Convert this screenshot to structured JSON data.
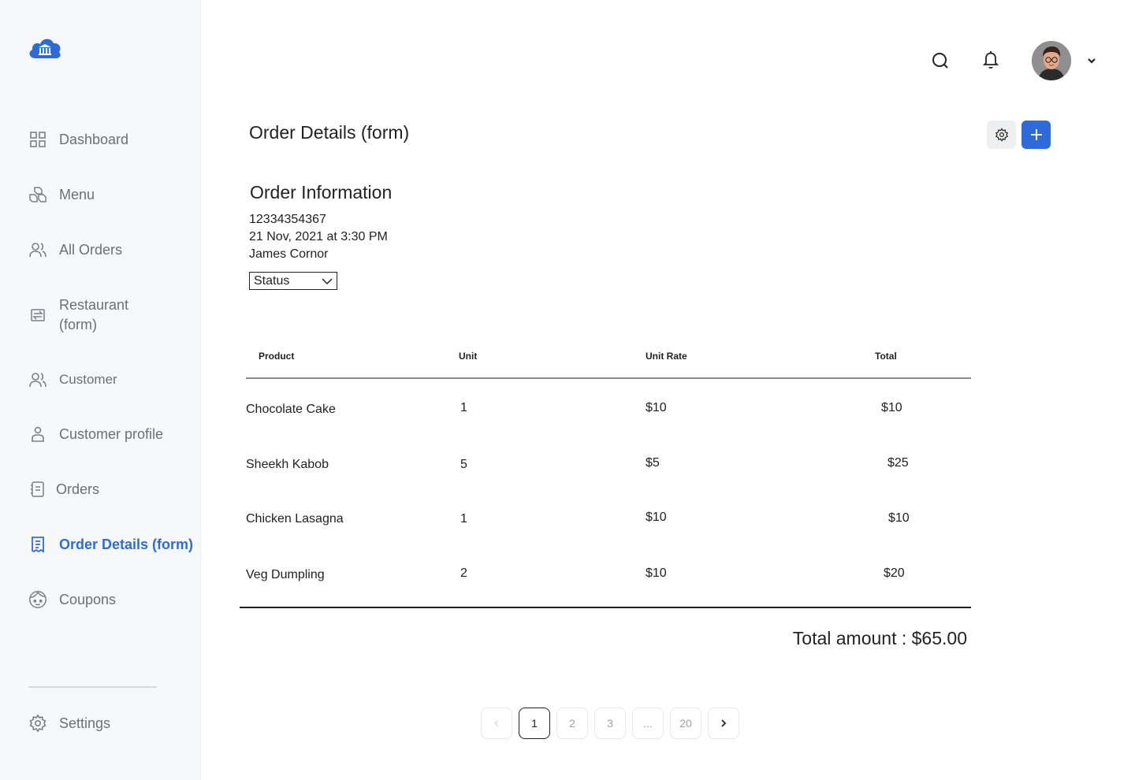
{
  "sidebar": {
    "items": [
      {
        "label": "Dashboard",
        "icon": "grid-icon"
      },
      {
        "label": "Menu",
        "icon": "boxes-icon"
      },
      {
        "label": "All Orders",
        "icon": "users-icon"
      },
      {
        "label": "Restaurant (form)",
        "icon": "transfer-icon"
      },
      {
        "label": "Customer",
        "icon": "users-icon"
      },
      {
        "label": "Customer profile",
        "icon": "person-icon"
      },
      {
        "label": "Orders",
        "icon": "receipt-list-icon"
      },
      {
        "label": "Order Details (form)",
        "icon": "document-icon",
        "active": true
      },
      {
        "label": "Coupons",
        "icon": "face-icon"
      }
    ],
    "settings_label": "Settings",
    "accent_color": "#2f6bd8"
  },
  "header": {
    "page_title": "Order Details (form)"
  },
  "order_info": {
    "title": "Order Information",
    "order_id": "12334354367",
    "date": "21 Nov, 2021 at 3:30 PM",
    "customer": "James Cornor",
    "status_label": "Status"
  },
  "table": {
    "headers": [
      "Product",
      "Unit",
      "Unit Rate",
      "Total"
    ],
    "rows": [
      {
        "product": "Chocolate Cake",
        "unit": "1",
        "rate": "$10",
        "total": "$10"
      },
      {
        "product": "Sheekh Kabob",
        "unit": "5",
        "rate": "$5",
        "total": "$25"
      },
      {
        "product": "Chicken Lasagna",
        "unit": "1",
        "rate": "$10",
        "total": "$10"
      },
      {
        "product": "Veg Dumpling",
        "unit": "2",
        "rate": "$10",
        "total": "$20"
      }
    ]
  },
  "total_text": "Total amount : $65.00",
  "pagination": {
    "pages": [
      "1",
      "2",
      "3",
      "...",
      "20"
    ],
    "current": "1"
  }
}
